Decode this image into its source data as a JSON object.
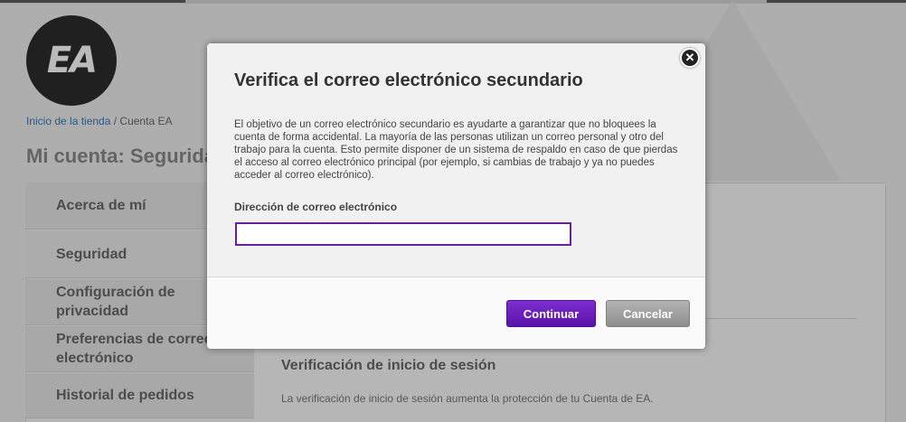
{
  "background": {
    "logo_text": "EA",
    "breadcrumb": {
      "store_link": "Inicio de la tienda",
      "separator": " / ",
      "current": "Cuenta EA"
    },
    "page_title": "Mi cuenta: Seguridad",
    "sidebar": {
      "items": [
        {
          "label": "Acerca de mí"
        },
        {
          "label": "Seguridad"
        },
        {
          "label": "Configuración de privacidad"
        },
        {
          "label": "Preferencias de correo electrónico"
        },
        {
          "label": "Historial de pedidos"
        }
      ]
    },
    "section": {
      "title": "Verificación de inicio de sesión",
      "text": "La verificación de inicio de sesión aumenta la protección de tu Cuenta de EA."
    }
  },
  "modal": {
    "title": "Verifica el correo electrónico secundario",
    "description": "El objetivo de un correo electrónico secundario es ayudarte a garantizar que no bloquees la cuenta de forma accidental. La mayoría de las personas utilizan un correo personal y otro del trabajo para la cuenta. Esto permite disponer de un sistema de respaldo en caso de que pierdas el acceso al correo electrónico principal (por ejemplo, si cambias de trabajo y ya no puedes acceder al correo electrónico).",
    "email_label": "Dirección de correo electrónico",
    "email_value": "",
    "continue_label": "Continuar",
    "cancel_label": "Cancelar",
    "close_symbol": "✕"
  },
  "colors": {
    "accent_purple": "#6a1f9a",
    "continue_button": "#6a1fbf",
    "cancel_button": "#9e9e9e",
    "link_blue": "#1c6aa8"
  },
  "icons": {
    "close": "close-icon",
    "logo": "ea-logo"
  }
}
